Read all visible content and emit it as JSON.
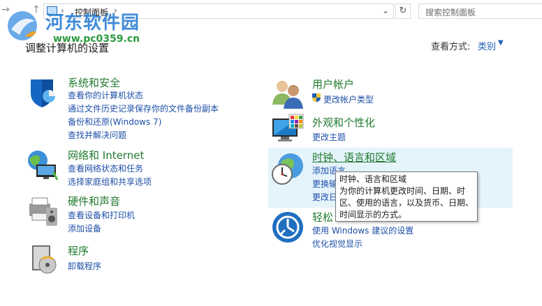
{
  "address_bar": {
    "breadcrumb": "控制面板",
    "search_placeholder": "搜索控制面板"
  },
  "watermark": {
    "title": "河东软件园",
    "url": "www.pc0359.cn"
  },
  "page": {
    "heading": "调整计算机的设置",
    "view_by_label": "查看方式:",
    "view_by_value": "类别"
  },
  "categories": {
    "system": {
      "title": "系统和安全",
      "links": [
        "查看你的计算机状态",
        "通过文件历史记录保存你的文件备份副本",
        "备份和还原(Windows 7)",
        "查找并解决问题"
      ]
    },
    "network": {
      "title": "网络和 Internet",
      "links": [
        "查看网络状态和任务",
        "选择家庭组和共享选项"
      ]
    },
    "hardware": {
      "title": "硬件和声音",
      "links": [
        "查看设备和打印机",
        "添加设备"
      ]
    },
    "programs": {
      "title": "程序",
      "links": [
        "卸载程序"
      ]
    },
    "user": {
      "title": "用户帐户",
      "links": [
        "更改帐户类型"
      ]
    },
    "appearance": {
      "title": "外观和个性化",
      "links": [
        "更改主题"
      ]
    },
    "clock": {
      "title": "时钟、语言和区域",
      "links": [
        "添加语言",
        "更换输",
        "更改日"
      ]
    },
    "ease": {
      "title": "轻松",
      "links": [
        "使用 Windows 建议的设置",
        "优化视觉显示"
      ]
    }
  },
  "tooltip": {
    "lines": [
      "时钟、语言和区域",
      "为你的计算机更改时间、日期、时",
      "区、使用的语言，以及货币、日期、",
      "时间显示的方式。"
    ]
  },
  "colors": {
    "title_green": "#1f7a2e",
    "link_blue": "#1d4fa8",
    "hover_bg": "#e5f3fb"
  }
}
